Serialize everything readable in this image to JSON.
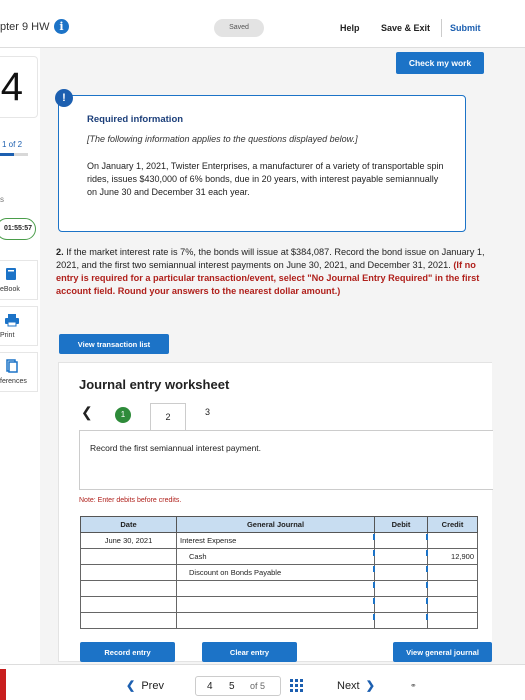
{
  "header": {
    "title": "pter 9 HW",
    "saved": "Saved",
    "help": "Help",
    "save_exit": "Save & Exit",
    "submit": "Submit"
  },
  "sidebar": {
    "question_number": "4",
    "page_indicator": "1 of 2",
    "progress_fraction": 0.5,
    "s_letter": "s",
    "timer": "01:55:57",
    "ebook": "eBook",
    "print": "Print",
    "references": "ferences"
  },
  "check_work": "Check my work",
  "required": {
    "badge": "!",
    "title": "Required information",
    "note": "[The following information applies to the questions displayed below.]",
    "text": "On January 1, 2021, Twister Enterprises, a manufacturer of a variety of transportable spin rides, issues $430,000 of 6% bonds, due in 20 years, with interest payable semiannually on June 30 and December 31 each year."
  },
  "question": {
    "number": "2.",
    "text": "If the market interest rate is 7%, the bonds will issue at $384,087. Record the bond issue on January 1, 2021, and the first two semiannual interest payments on June 30, 2021, and December 31, 2021.",
    "instruction": "(If no entry is required for a particular transaction/event, select \"No Journal Entry Required\" in the first account field. Round your answers to the nearest dollar amount.)"
  },
  "view_transaction_list": "View transaction list",
  "worksheet": {
    "title": "Journal entry worksheet",
    "steps": [
      "1",
      "2",
      "3"
    ],
    "description": "Record the first semiannual interest payment.",
    "note": "Note: Enter debits before credits.",
    "columns": [
      "Date",
      "General Journal",
      "Debit",
      "Credit"
    ],
    "rows": [
      {
        "date": "June 30, 2021",
        "account": "Interest Expense",
        "debit": "",
        "credit": ""
      },
      {
        "date": "",
        "account": "Cash",
        "debit": "",
        "credit": "12,900"
      },
      {
        "date": "",
        "account": "Discount on Bonds Payable",
        "debit": "",
        "credit": ""
      },
      {
        "date": "",
        "account": "",
        "debit": "",
        "credit": ""
      },
      {
        "date": "",
        "account": "",
        "debit": "",
        "credit": ""
      },
      {
        "date": "",
        "account": "",
        "debit": "",
        "credit": ""
      }
    ],
    "record_entry": "Record entry",
    "clear_entry": "Clear entry",
    "view_general_journal": "View general journal"
  },
  "footer": {
    "prev": "Prev",
    "page_current": "4",
    "page_next": "5",
    "page_of": "of 5",
    "next": "Next"
  },
  "colors": {
    "accent": "#1c73c7",
    "instruction_red": "#b0211c",
    "step_green": "#2e8b3a",
    "header_cell": "#c8ddf1"
  }
}
